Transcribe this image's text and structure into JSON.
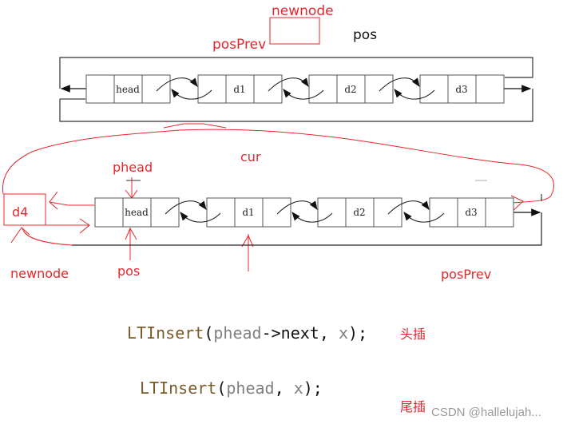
{
  "top_diagram": {
    "labels": {
      "newnode": "newnode",
      "posPrev": "posPrev",
      "pos": "pos"
    },
    "nodes": [
      "head",
      "d1",
      "d2",
      "d3"
    ]
  },
  "bottom_diagram": {
    "labels": {
      "phead": "phead",
      "cur": "cur",
      "newnode": "newnode",
      "pos": "pos",
      "posPrev": "posPrev"
    },
    "new_node": "d4",
    "nodes": [
      "head",
      "d1",
      "d2",
      "d3"
    ]
  },
  "code": {
    "line1": {
      "fn": "LTInsert",
      "open": "(",
      "arg1": "phead",
      "arrow": "->next",
      "comma": ", ",
      "arg2": "x",
      "close": ");"
    },
    "line1_note": "头插",
    "line2": {
      "fn": "LTInsert",
      "open": "(",
      "arg1": "phead",
      "comma": ", ",
      "arg2": "x",
      "close": ");"
    },
    "line2_note": "尾插"
  },
  "watermark": "CSDN @hallelujah...",
  "colors": {
    "annotation": "#e8262b",
    "line": "#333333",
    "code_fn": "#7a5a28",
    "code_param": "#808080"
  }
}
